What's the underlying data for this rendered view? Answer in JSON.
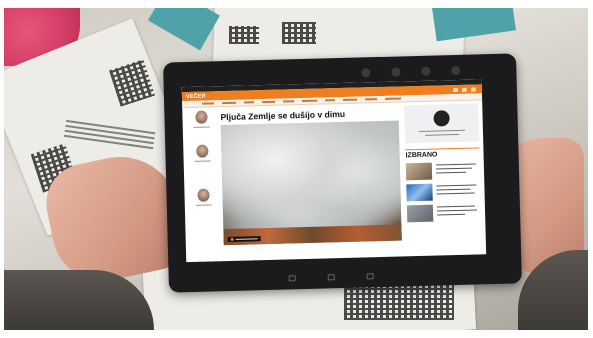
{
  "app": {
    "logo_text": "VEČER"
  },
  "article": {
    "headline": "Pljuča Zemlje se dušijo v dimu"
  },
  "sidebar": {
    "section_heading": "IZBRANO"
  },
  "colors": {
    "brand_orange": "#f07d1e",
    "tablet_bezel": "#1b1b1d",
    "page_bg": "#ffffff"
  },
  "icons": [
    "menu-icon",
    "user-icon",
    "search-icon",
    "camera-icon",
    "home-icon",
    "back-icon"
  ]
}
